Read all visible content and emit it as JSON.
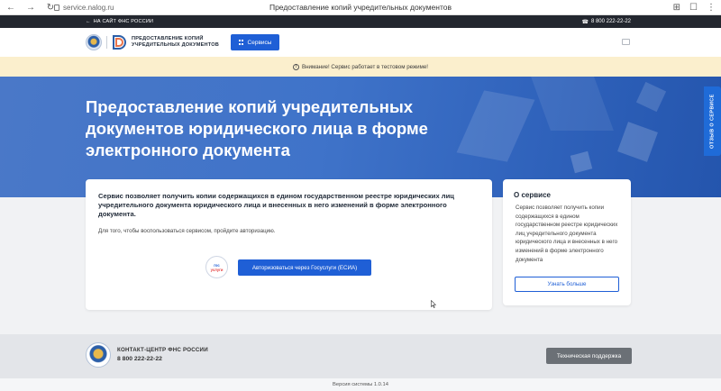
{
  "browser": {
    "url": "service.nalog.ru",
    "tab_title": "Предоставление копий учредительных документов"
  },
  "topstrip": {
    "back_link": "НА САЙТ ФНС РОССИИ",
    "phone": "8 800 222-22-22"
  },
  "header": {
    "brand_line1": "ПРЕДОСТАВЛЕНИЕ КОПИЙ",
    "brand_line2": "УЧРЕДИТЕЛЬНЫХ ДОКУМЕНТОВ",
    "services_label": "Сервисы"
  },
  "warning": {
    "text": "Внимание! Сервис работает в тестовом режиме!"
  },
  "hero": {
    "title": "Предоставление копий учредительных документов юридического лица в форме электронного документа",
    "feedback_tab": "ОТЗЫВ О СЕРВИСЕ"
  },
  "main_card": {
    "description": "Сервис позволяет получить копии содержащихся в едином государственном реестре юридических лиц учредительного документа юридического лица и внесенных в него изменений в форме электронного документа.",
    "hint": "Для того, чтобы воспользоваться сервисом, пройдите авторизацию.",
    "gos_logo_line1": "гос",
    "gos_logo_line2": "услуги",
    "auth_button": "Авторизоваться через Госуслуги (ЕСИА)"
  },
  "side_card": {
    "title": "О сервисе",
    "text": "Сервис позволяет получить копии содержащихся в едином государственном реестре юридических лиц учредительного документа юридического лица и внесенных в него изменений в форме электронного документа",
    "learn_more": "Узнать больше"
  },
  "footer": {
    "contact_title": "КОНТАКТ-ЦЕНТР ФНС РОССИИ",
    "contact_phone": "8 800 222-22-22",
    "support_button": "Техническая поддержка",
    "version": "Версия системы 1.0.14"
  },
  "colors": {
    "primary": "#1f5fd6",
    "hero": "#3f73c9",
    "warning_bg": "#fbefcd",
    "dark_strip": "#23272f"
  }
}
